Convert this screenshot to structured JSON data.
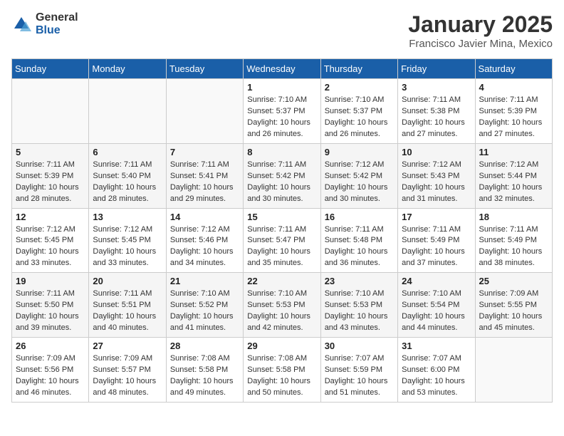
{
  "logo": {
    "general": "General",
    "blue": "Blue"
  },
  "header": {
    "month": "January 2025",
    "location": "Francisco Javier Mina, Mexico"
  },
  "weekdays": [
    "Sunday",
    "Monday",
    "Tuesday",
    "Wednesday",
    "Thursday",
    "Friday",
    "Saturday"
  ],
  "weeks": [
    [
      {
        "day": "",
        "sunrise": "",
        "sunset": "",
        "daylight": ""
      },
      {
        "day": "",
        "sunrise": "",
        "sunset": "",
        "daylight": ""
      },
      {
        "day": "",
        "sunrise": "",
        "sunset": "",
        "daylight": ""
      },
      {
        "day": "1",
        "sunrise": "Sunrise: 7:10 AM",
        "sunset": "Sunset: 5:37 PM",
        "daylight": "Daylight: 10 hours and 26 minutes."
      },
      {
        "day": "2",
        "sunrise": "Sunrise: 7:10 AM",
        "sunset": "Sunset: 5:37 PM",
        "daylight": "Daylight: 10 hours and 26 minutes."
      },
      {
        "day": "3",
        "sunrise": "Sunrise: 7:11 AM",
        "sunset": "Sunset: 5:38 PM",
        "daylight": "Daylight: 10 hours and 27 minutes."
      },
      {
        "day": "4",
        "sunrise": "Sunrise: 7:11 AM",
        "sunset": "Sunset: 5:39 PM",
        "daylight": "Daylight: 10 hours and 27 minutes."
      }
    ],
    [
      {
        "day": "5",
        "sunrise": "Sunrise: 7:11 AM",
        "sunset": "Sunset: 5:39 PM",
        "daylight": "Daylight: 10 hours and 28 minutes."
      },
      {
        "day": "6",
        "sunrise": "Sunrise: 7:11 AM",
        "sunset": "Sunset: 5:40 PM",
        "daylight": "Daylight: 10 hours and 28 minutes."
      },
      {
        "day": "7",
        "sunrise": "Sunrise: 7:11 AM",
        "sunset": "Sunset: 5:41 PM",
        "daylight": "Daylight: 10 hours and 29 minutes."
      },
      {
        "day": "8",
        "sunrise": "Sunrise: 7:11 AM",
        "sunset": "Sunset: 5:42 PM",
        "daylight": "Daylight: 10 hours and 30 minutes."
      },
      {
        "day": "9",
        "sunrise": "Sunrise: 7:12 AM",
        "sunset": "Sunset: 5:42 PM",
        "daylight": "Daylight: 10 hours and 30 minutes."
      },
      {
        "day": "10",
        "sunrise": "Sunrise: 7:12 AM",
        "sunset": "Sunset: 5:43 PM",
        "daylight": "Daylight: 10 hours and 31 minutes."
      },
      {
        "day": "11",
        "sunrise": "Sunrise: 7:12 AM",
        "sunset": "Sunset: 5:44 PM",
        "daylight": "Daylight: 10 hours and 32 minutes."
      }
    ],
    [
      {
        "day": "12",
        "sunrise": "Sunrise: 7:12 AM",
        "sunset": "Sunset: 5:45 PM",
        "daylight": "Daylight: 10 hours and 33 minutes."
      },
      {
        "day": "13",
        "sunrise": "Sunrise: 7:12 AM",
        "sunset": "Sunset: 5:45 PM",
        "daylight": "Daylight: 10 hours and 33 minutes."
      },
      {
        "day": "14",
        "sunrise": "Sunrise: 7:12 AM",
        "sunset": "Sunset: 5:46 PM",
        "daylight": "Daylight: 10 hours and 34 minutes."
      },
      {
        "day": "15",
        "sunrise": "Sunrise: 7:11 AM",
        "sunset": "Sunset: 5:47 PM",
        "daylight": "Daylight: 10 hours and 35 minutes."
      },
      {
        "day": "16",
        "sunrise": "Sunrise: 7:11 AM",
        "sunset": "Sunset: 5:48 PM",
        "daylight": "Daylight: 10 hours and 36 minutes."
      },
      {
        "day": "17",
        "sunrise": "Sunrise: 7:11 AM",
        "sunset": "Sunset: 5:49 PM",
        "daylight": "Daylight: 10 hours and 37 minutes."
      },
      {
        "day": "18",
        "sunrise": "Sunrise: 7:11 AM",
        "sunset": "Sunset: 5:49 PM",
        "daylight": "Daylight: 10 hours and 38 minutes."
      }
    ],
    [
      {
        "day": "19",
        "sunrise": "Sunrise: 7:11 AM",
        "sunset": "Sunset: 5:50 PM",
        "daylight": "Daylight: 10 hours and 39 minutes."
      },
      {
        "day": "20",
        "sunrise": "Sunrise: 7:11 AM",
        "sunset": "Sunset: 5:51 PM",
        "daylight": "Daylight: 10 hours and 40 minutes."
      },
      {
        "day": "21",
        "sunrise": "Sunrise: 7:10 AM",
        "sunset": "Sunset: 5:52 PM",
        "daylight": "Daylight: 10 hours and 41 minutes."
      },
      {
        "day": "22",
        "sunrise": "Sunrise: 7:10 AM",
        "sunset": "Sunset: 5:53 PM",
        "daylight": "Daylight: 10 hours and 42 minutes."
      },
      {
        "day": "23",
        "sunrise": "Sunrise: 7:10 AM",
        "sunset": "Sunset: 5:53 PM",
        "daylight": "Daylight: 10 hours and 43 minutes."
      },
      {
        "day": "24",
        "sunrise": "Sunrise: 7:10 AM",
        "sunset": "Sunset: 5:54 PM",
        "daylight": "Daylight: 10 hours and 44 minutes."
      },
      {
        "day": "25",
        "sunrise": "Sunrise: 7:09 AM",
        "sunset": "Sunset: 5:55 PM",
        "daylight": "Daylight: 10 hours and 45 minutes."
      }
    ],
    [
      {
        "day": "26",
        "sunrise": "Sunrise: 7:09 AM",
        "sunset": "Sunset: 5:56 PM",
        "daylight": "Daylight: 10 hours and 46 minutes."
      },
      {
        "day": "27",
        "sunrise": "Sunrise: 7:09 AM",
        "sunset": "Sunset: 5:57 PM",
        "daylight": "Daylight: 10 hours and 48 minutes."
      },
      {
        "day": "28",
        "sunrise": "Sunrise: 7:08 AM",
        "sunset": "Sunset: 5:58 PM",
        "daylight": "Daylight: 10 hours and 49 minutes."
      },
      {
        "day": "29",
        "sunrise": "Sunrise: 7:08 AM",
        "sunset": "Sunset: 5:58 PM",
        "daylight": "Daylight: 10 hours and 50 minutes."
      },
      {
        "day": "30",
        "sunrise": "Sunrise: 7:07 AM",
        "sunset": "Sunset: 5:59 PM",
        "daylight": "Daylight: 10 hours and 51 minutes."
      },
      {
        "day": "31",
        "sunrise": "Sunrise: 7:07 AM",
        "sunset": "Sunset: 6:00 PM",
        "daylight": "Daylight: 10 hours and 53 minutes."
      },
      {
        "day": "",
        "sunrise": "",
        "sunset": "",
        "daylight": ""
      }
    ]
  ]
}
